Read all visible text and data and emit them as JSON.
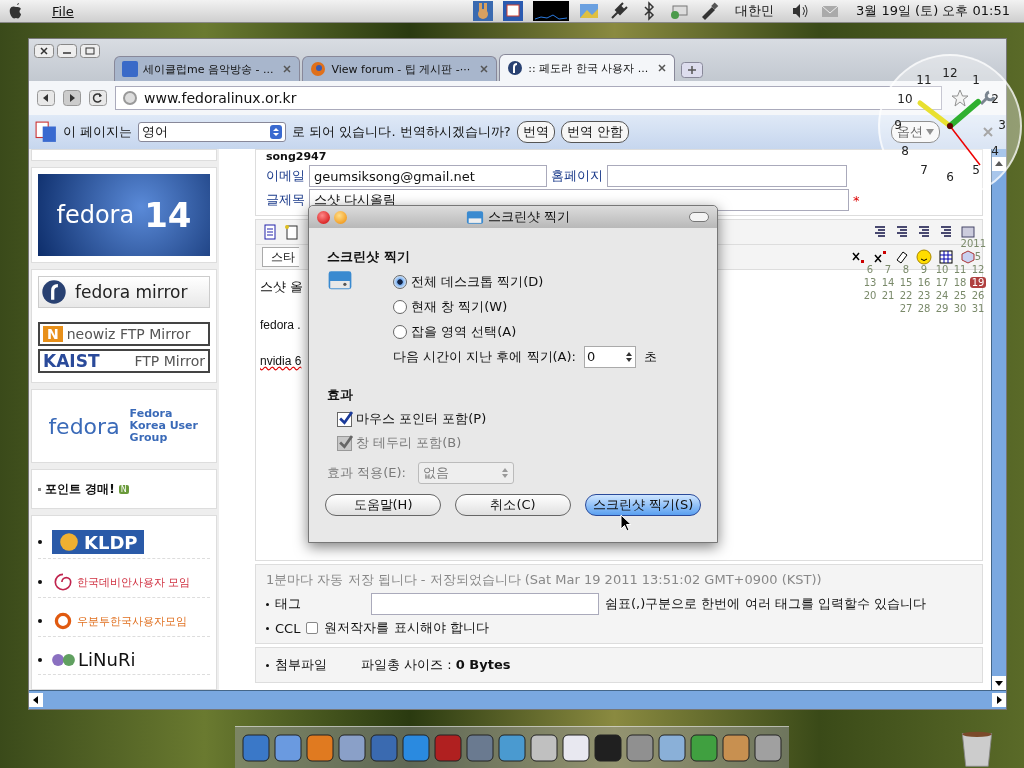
{
  "menubar": {
    "app_menu": "File",
    "input_method": "대한민",
    "clock": "3월 19일 (토) 오후 01:51"
  },
  "browser": {
    "tabs": [
      {
        "title": "세이클럽me 음악방송 - ...",
        "kind": "me",
        "selected": false
      },
      {
        "title": "View forum - 팁 게시판 -···",
        "kind": "fox",
        "selected": false
      },
      {
        "title": ":: 페도라 한국 사용자 ...",
        "kind": "fedora",
        "selected": true
      }
    ],
    "address": "www.fedoralinux.or.kr",
    "translate_bar": {
      "prefix": "이 페이지는",
      "language": "영어",
      "suffix": "로 되어 있습니다. 번역하시겠습니까?",
      "buttons": [
        "번역",
        "번역 안함"
      ],
      "options": "옵션"
    }
  },
  "sidebar": {
    "fedora_banner": {
      "word": "fedora",
      "version": "14"
    },
    "mirror_title": "fedora mirror",
    "mirrors": [
      {
        "logo": "N",
        "name": "neowiz FTP Mirror",
        "kind": "neowiz"
      },
      {
        "logo": "KAIST",
        "name": "FTP Mirror",
        "kind": "kaist"
      }
    ],
    "group": {
      "word": "fedora",
      "name": "Fedora Korea User Group"
    },
    "notice": {
      "text": "포인트 경매!",
      "badge": "N"
    },
    "links": [
      {
        "text": "KLDP",
        "kind": "kldp"
      },
      {
        "text": "한국데비안사용자 모임",
        "kind": "debian"
      },
      {
        "text": "우분투한국사용자모임",
        "kind": "ubuntu"
      },
      {
        "text": "LiNuRi",
        "kind": "linuri"
      }
    ]
  },
  "form": {
    "author": "song2947",
    "fields": [
      {
        "label": "이메일",
        "value": "geumsiksong@gmail.net"
      },
      {
        "label": "홈페이지"
      }
    ],
    "subject": {
      "label": "글제목",
      "value": "스샷 다시올림",
      "required": "*"
    },
    "editor": {
      "style_select": "스타",
      "lines": [
        "스샷 올",
        "fedora .",
        "nvidia 6"
      ]
    },
    "autosave": "1분마다 자동 저장 됩니다 - 저장되었습니다 (Sat Mar 19 2011 13:51:02 GMT+0900 (KST))",
    "tag": {
      "label": "태그",
      "hint": "쉼표(,)구분으로 한번에 여러 태그를 입력할수 있습니다"
    },
    "ccl": {
      "label": "CCL",
      "text": "원저작자를 표시해야 합니다",
      "checked": false
    },
    "attachment": {
      "label": "첨부파일",
      "size": "파일총 사이즈 : **0 Bytes**"
    }
  },
  "dialog": {
    "title": "스크린샷 찍기",
    "section": "스크린샷 찍기",
    "options": [
      {
        "label": "전체 데스크톱 찍기(D)",
        "selected": true
      },
      {
        "label": "현재 창 찍기(W)",
        "selected": false
      },
      {
        "label": "잡을 영역 선택(A)",
        "selected": false
      }
    ],
    "delay": {
      "label": "다음 시간이 지난 후에 찍기(A):",
      "value": "0",
      "unit": "초"
    },
    "effects_title": "효과",
    "effects": [
      {
        "label": "마우스 포인터 포함(P)",
        "checked": true,
        "disabled": false
      },
      {
        "label": "창 테두리 포함(B)",
        "checked": true,
        "disabled": true
      }
    ],
    "apply": {
      "label": "효과 적용(E):",
      "value": "없음",
      "disabled": true
    },
    "buttons": [
      {
        "label": "도움말(H)",
        "kind": "normal"
      },
      {
        "label": "취소(C)",
        "kind": "normal"
      },
      {
        "label": "스크린샷 찍기(S)",
        "kind": "default"
      }
    ]
  },
  "clock_widget": {
    "numbers": [
      "12",
      "1",
      "2",
      "3",
      "4",
      "5",
      "6",
      "7",
      "8",
      "9",
      "10",
      "11"
    ]
  },
  "calendar_widget": {
    "year": "2011",
    "weeks": [
      [
        {
          "day": "5",
          "selected": false
        }
      ],
      [
        {
          "day": "6",
          "selected": false
        },
        {
          "day": "7",
          "selected": false
        },
        {
          "day": "8",
          "selected": false
        },
        {
          "day": "9",
          "selected": false
        },
        {
          "day": "10",
          "selected": false
        },
        {
          "day": "11",
          "selected": false
        },
        {
          "day": "12",
          "selected": false
        }
      ],
      [
        {
          "day": "13",
          "selected": false
        },
        {
          "day": "14",
          "selected": false
        },
        {
          "day": "15",
          "selected": false
        },
        {
          "day": "16",
          "selected": false
        },
        {
          "day": "17",
          "selected": false
        },
        {
          "day": "18",
          "selected": false
        },
        {
          "day": "19",
          "selected": true
        }
      ],
      [
        {
          "day": "20",
          "selected": false
        },
        {
          "day": "21",
          "selected": false
        },
        {
          "day": "22",
          "selected": false
        },
        {
          "day": "23",
          "selected": false
        },
        {
          "day": "24",
          "selected": false
        },
        {
          "day": "25",
          "selected": false
        },
        {
          "day": "26",
          "selected": false
        }
      ],
      [
        {
          "day": "27",
          "selected": false
        },
        {
          "day": "28",
          "selected": false
        },
        {
          "day": "29",
          "selected": false
        },
        {
          "day": "30",
          "selected": false
        },
        {
          "day": "31",
          "selected": false
        }
      ]
    ]
  }
}
